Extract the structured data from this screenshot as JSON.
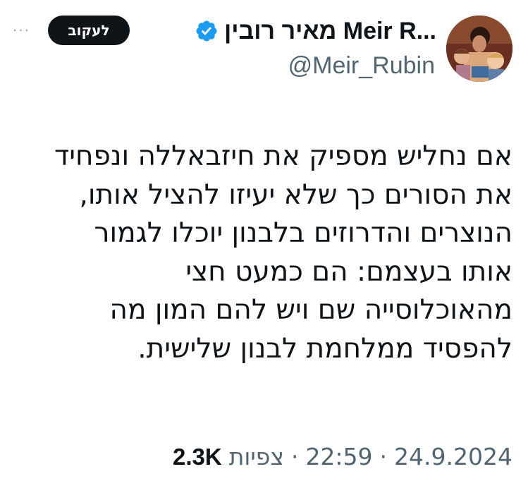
{
  "author": {
    "display_name": "מאיר רובין Meir R...",
    "handle": "@Meir_Rubin",
    "verified": true
  },
  "actions": {
    "follow_label": "לעקוב",
    "more_label": "···"
  },
  "tweet": {
    "lines": [
      "אם נחליש מספיק את חיזבאללה ונפחיד",
      "את הסורים כך שלא יעיזו להציל אותו,",
      "הנוצרים והדרוזים בלבנון יוכלו לגמור",
      "אותו בעצמם: הם כמעט חצי",
      "מהאוכלוסייה שם ויש להם המון מה",
      "להפסיד ממלחמת לבנון שלישית."
    ]
  },
  "meta": {
    "date": "24.9.2024",
    "time": "22:59",
    "views_count": "2.3K",
    "views_label": "צפיות"
  },
  "colors": {
    "verified_badge": "#1d9bf0",
    "follow_button_bg": "#0f1419",
    "secondary_text": "#536471"
  }
}
